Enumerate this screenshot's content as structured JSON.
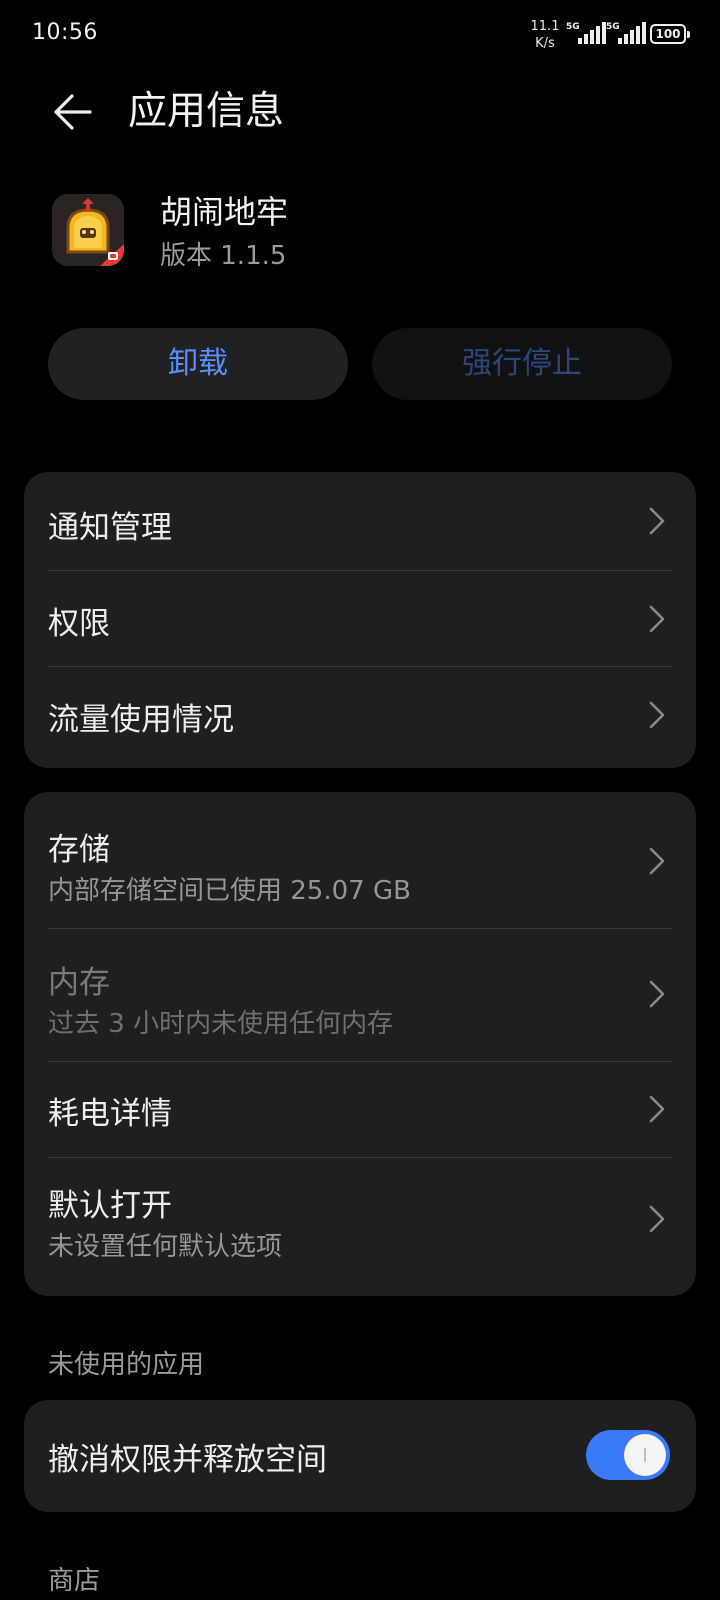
{
  "status_bar": {
    "time": "10:56",
    "net_speed_value": "11.1",
    "net_speed_unit": "K/s",
    "signal1_gen": "5G",
    "signal2_gen": "5G",
    "battery": "100"
  },
  "header": {
    "back_icon": "arrow-left-icon",
    "title": "应用信息"
  },
  "app": {
    "icon": "app-icon-game",
    "name": "胡闹地牢",
    "version": "版本 1.1.5"
  },
  "actions": {
    "uninstall": "卸载",
    "force_stop": "强行停止"
  },
  "group1": {
    "items": [
      {
        "title": "通知管理"
      },
      {
        "title": "权限"
      },
      {
        "title": "流量使用情况"
      }
    ]
  },
  "group2": {
    "items": [
      {
        "title": "存储",
        "subtitle": "内部存储空间已使用 25.07 GB"
      },
      {
        "title": "内存",
        "subtitle": "过去 3 小时内未使用任何内存"
      },
      {
        "title": "耗电详情"
      },
      {
        "title": "默认打开",
        "subtitle": "未设置任何默认选项"
      }
    ]
  },
  "unused_apps": {
    "section_label": "未使用的应用",
    "toggle_label": "撤消权限并释放空间",
    "toggle_on": true
  },
  "store": {
    "section_label": "商店"
  },
  "colors": {
    "accent": "#3a79f7",
    "uninstall_text": "#5a8ef8",
    "card_bg": "#1f1f21"
  }
}
